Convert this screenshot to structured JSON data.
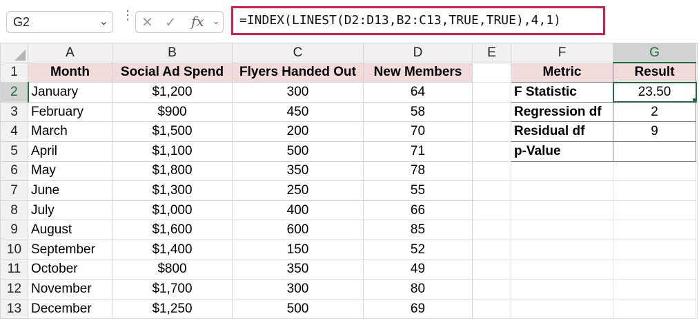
{
  "name_box": {
    "value": "G2"
  },
  "formula_bar": {
    "formula": "=INDEX(LINEST(D2:D13,B2:C13,TRUE,TRUE),4,1)",
    "fx_label": "fx",
    "cancel_icon": "close-icon",
    "enter_icon": "check-icon"
  },
  "colors": {
    "header_fill": "#f2dcdb",
    "accent": "#1e6f3e",
    "formula_border": "#d81b4b"
  },
  "columns": [
    "A",
    "B",
    "C",
    "D",
    "E",
    "F",
    "G"
  ],
  "rows": [
    "1",
    "2",
    "3",
    "4",
    "5",
    "6",
    "7",
    "8",
    "9",
    "10",
    "11",
    "12",
    "13"
  ],
  "selected_column": "G",
  "selected_row": "2",
  "data_table": {
    "headers": [
      "Month",
      "Social Ad Spend",
      "Flyers Handed Out",
      "New Members"
    ],
    "rows": [
      [
        "January",
        "$1,200",
        "300",
        "64"
      ],
      [
        "February",
        "$900",
        "450",
        "58"
      ],
      [
        "March",
        "$1,500",
        "200",
        "70"
      ],
      [
        "April",
        "$1,100",
        "500",
        "71"
      ],
      [
        "May",
        "$1,800",
        "350",
        "78"
      ],
      [
        "June",
        "$1,300",
        "250",
        "55"
      ],
      [
        "July",
        "$1,000",
        "400",
        "66"
      ],
      [
        "August",
        "$1,600",
        "600",
        "85"
      ],
      [
        "September",
        "$1,400",
        "150",
        "52"
      ],
      [
        "October",
        "$800",
        "350",
        "49"
      ],
      [
        "November",
        "$1,700",
        "300",
        "80"
      ],
      [
        "December",
        "$1,250",
        "500",
        "69"
      ]
    ]
  },
  "metrics_table": {
    "headers": [
      "Metric",
      "Result"
    ],
    "rows": [
      [
        "F Statistic",
        "23.50"
      ],
      [
        "Regression df",
        "2"
      ],
      [
        "Residual df",
        "9"
      ],
      [
        "p-Value",
        ""
      ]
    ]
  }
}
